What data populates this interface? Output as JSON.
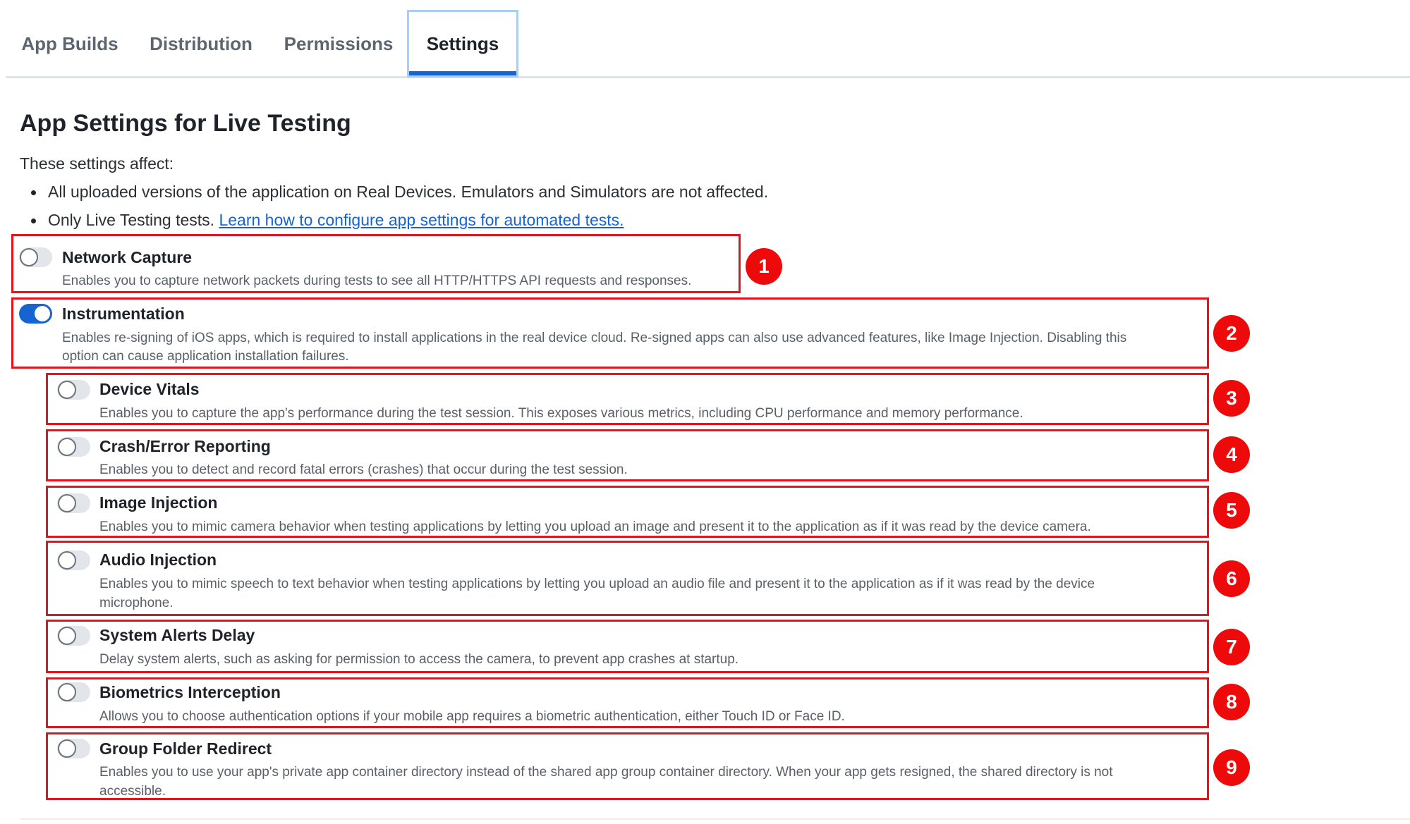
{
  "tabs": [
    {
      "label": "App Builds",
      "active": false
    },
    {
      "label": "Distribution",
      "active": false
    },
    {
      "label": "Permissions",
      "active": false
    },
    {
      "label": "Settings",
      "active": true
    }
  ],
  "page_title": "App Settings for Live Testing",
  "intro": "These settings affect:",
  "bullets": {
    "first": "All uploaded versions of the application on Real Devices. Emulators and Simulators are not affected.",
    "second_text": "Only Live Testing tests.",
    "second_link": "Learn how to configure app settings for automated tests."
  },
  "settings": [
    {
      "title": "Network Capture",
      "description": "Enables you to capture network packets during tests to see all HTTP/HTTPS API requests and responses.",
      "enabled": false,
      "badge": "1"
    },
    {
      "title": "Instrumentation",
      "description_line1": "Enables re-signing of iOS apps, which is required to install applications in the real device cloud. Re-signed apps can also use advanced features, like Image Injection. Disabling this",
      "description_line2": "option can cause application installation failures.",
      "enabled": true,
      "badge": "2"
    },
    {
      "title": "Device Vitals",
      "description": "Enables you to capture the app's performance during the test session. This exposes various metrics, including CPU performance and memory performance.",
      "enabled": false,
      "badge": "3"
    },
    {
      "title": "Crash/Error Reporting",
      "description": "Enables you to detect and record fatal errors (crashes) that occur during the test session.",
      "enabled": false,
      "badge": "4"
    },
    {
      "title": "Image Injection",
      "description": "Enables you to mimic camera behavior when testing applications by letting you upload an image and present it to the application as if it was read by the device camera.",
      "enabled": false,
      "badge": "5"
    },
    {
      "title": "Audio Injection",
      "description_line1": "Enables you to mimic speech to text behavior when testing applications by letting you upload an audio file and present it to the application as if it was read by the device",
      "description_line2": "microphone.",
      "enabled": false,
      "badge": "6"
    },
    {
      "title": "System Alerts Delay",
      "description": "Delay system alerts, such as asking for permission to access the camera, to prevent app crashes at startup.",
      "enabled": false,
      "badge": "7"
    },
    {
      "title": "Biometrics Interception",
      "description": "Allows you to choose authentication options if your mobile app requires a biometric authentication, either Touch ID or Face ID.",
      "enabled": false,
      "badge": "8"
    },
    {
      "title": "Group Folder Redirect",
      "description_line1": "Enables you to use your app's private app container directory instead of the shared app group container directory. When your app gets resigned, the shared directory is not",
      "description_line2": "accessible.",
      "enabled": false,
      "badge": "9"
    }
  ],
  "colors": {
    "accent": "#1664d2",
    "highlight": "#e3141c",
    "badge": "#ee0a0a"
  }
}
